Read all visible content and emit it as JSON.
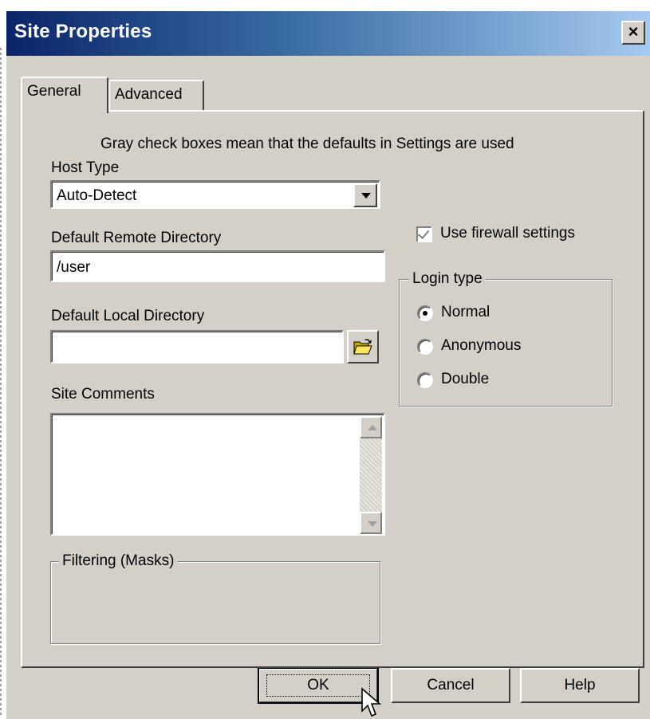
{
  "window": {
    "title": "Site Properties",
    "close_glyph": "×"
  },
  "tabs": [
    {
      "label": "General",
      "active": true
    },
    {
      "label": "Advanced",
      "active": false
    }
  ],
  "general": {
    "note": "Gray check boxes mean that the defaults in Settings are used",
    "host_type": {
      "label": "Host Type",
      "value": "Auto-Detect"
    },
    "remote_dir": {
      "label": "Default Remote Directory",
      "value": "/user"
    },
    "local_dir": {
      "label": "Default Local Directory",
      "value": ""
    },
    "comments": {
      "label": "Site Comments",
      "value": ""
    },
    "filtering": {
      "label": "Filtering (Masks)"
    },
    "firewall": {
      "label": "Use firewall settings",
      "checked": true,
      "grayed": true
    },
    "login_type": {
      "label": "Login type",
      "options": [
        {
          "label": "Normal",
          "selected": true
        },
        {
          "label": "Anonymous",
          "selected": false
        },
        {
          "label": "Double",
          "selected": false
        }
      ]
    }
  },
  "buttons": {
    "ok": "OK",
    "cancel": "Cancel",
    "help": "Help"
  },
  "colors": {
    "dialog_bg": "#d4d0c8",
    "title_start": "#0a246a",
    "title_end": "#a6caf0"
  }
}
